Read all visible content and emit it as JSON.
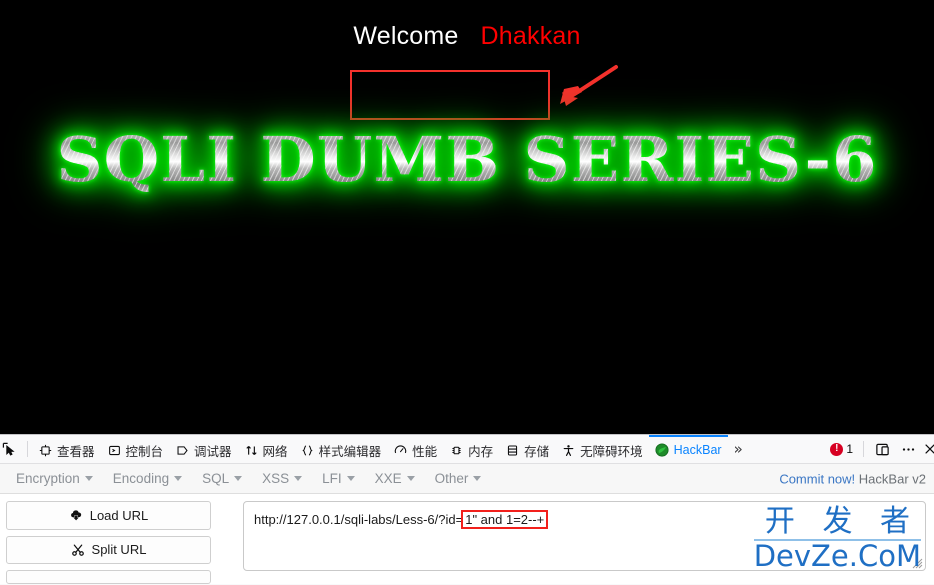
{
  "page": {
    "welcome_label": "Welcome",
    "user_label": "Dhakkan",
    "title": "SQLI DUMB SERIES-6",
    "background_color": "#000000",
    "user_color": "#ff0000",
    "title_glow_color": "#00c400",
    "annotation_color": "#f4312c"
  },
  "devtools": {
    "picker_icon": "element-picker-icon",
    "tabs": [
      {
        "label": "查看器",
        "icon": "inspector-icon",
        "active": false
      },
      {
        "label": "控制台",
        "icon": "console-icon",
        "active": false
      },
      {
        "label": "调试器",
        "icon": "debugger-icon",
        "active": false
      },
      {
        "label": "网络",
        "icon": "network-icon",
        "active": false
      },
      {
        "label": "样式编辑器",
        "icon": "style-editor-icon",
        "active": false
      },
      {
        "label": "性能",
        "icon": "performance-icon",
        "active": false
      },
      {
        "label": "内存",
        "icon": "memory-icon",
        "active": false
      },
      {
        "label": "存储",
        "icon": "storage-icon",
        "active": false
      },
      {
        "label": "无障碍环境",
        "icon": "accessibility-icon",
        "active": false
      },
      {
        "label": "HackBar",
        "icon": "hackbar-icon",
        "active": true
      }
    ],
    "overflow_label": "»",
    "error_count": "1",
    "dock_icon": "dock-split-icon",
    "meatball_icon": "more-options-icon",
    "close_icon": "close-icon",
    "active_tab_color": "#0a84ff",
    "error_badge_color": "#d70022"
  },
  "hackbar": {
    "menus": [
      {
        "label": "Encryption"
      },
      {
        "label": "Encoding"
      },
      {
        "label": "SQL"
      },
      {
        "label": "XSS"
      },
      {
        "label": "LFI"
      },
      {
        "label": "XXE"
      },
      {
        "label": "Other"
      }
    ],
    "commit_link_label": "Commit now!",
    "version_label": "HackBar v2",
    "buttons": [
      {
        "label": "Load URL",
        "icon": "cloud-download-icon"
      },
      {
        "label": "Split URL",
        "icon": "scissors-icon"
      },
      {
        "label": "",
        "icon": "execute-icon"
      }
    ],
    "url": {
      "prefix": "http://127.0.0.1/sqli-labs/Less-6/?id=",
      "payload": "1\" and 1=2--+",
      "full_value": "http://127.0.0.1/sqli-labs/Less-6/?id=1\" and 1=2--+",
      "placeholder": "",
      "highlight_color": "#f2201c"
    }
  },
  "watermark": {
    "chinese": "开 发 者",
    "latin": "DevZe.CoM",
    "color": "#1f6fc4"
  }
}
